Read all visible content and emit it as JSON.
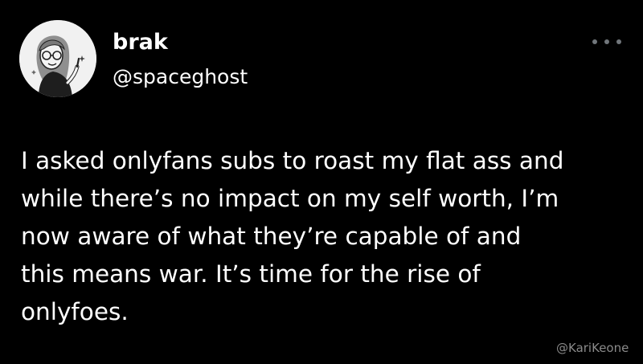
{
  "tweet": {
    "author": {
      "display_name": "brak",
      "handle": "@spaceghost",
      "avatar_icon": "cartoon-woman-pointing-avatar"
    },
    "more_menu_icon": "ellipsis-icon",
    "text_lines": [
      "I asked onlyfans subs to roast my flat ass and",
      "while there’s no impact on my self worth, I’m",
      "now aware of what they’re capable of and",
      "this means war. It’s time for the rise of",
      "onlyfoes."
    ]
  },
  "watermark": "@KariKeone",
  "colors": {
    "background": "#000000",
    "text": "#ffffff",
    "muted": "#71767b",
    "watermark": "#8a8a8a"
  }
}
